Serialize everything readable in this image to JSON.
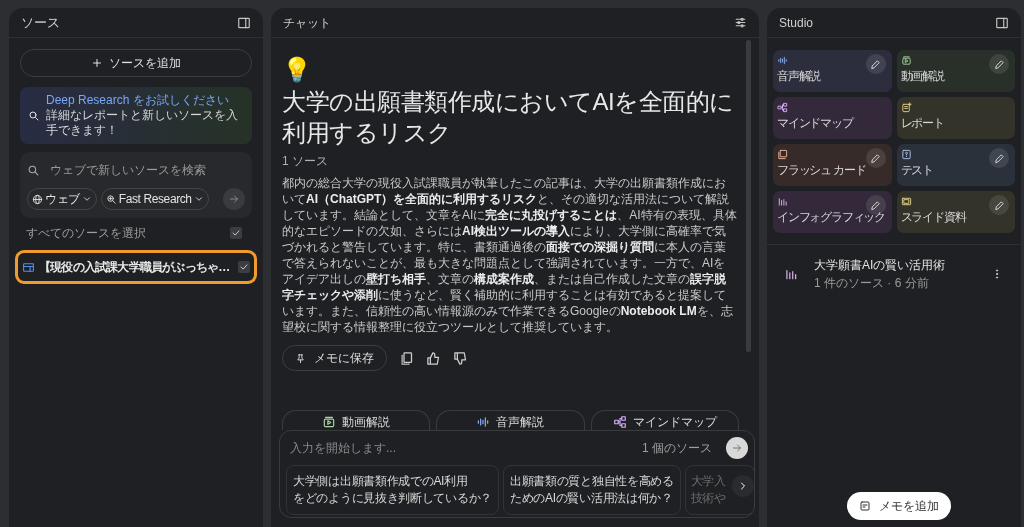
{
  "sources_panel": {
    "title": "ソース",
    "add_button": "ソースを追加",
    "promo": {
      "link": "Deep Research をお試しください",
      "text": "詳細なレポートと新しいソースを入手できます！"
    },
    "search": {
      "placeholder": "ウェブで新しいソースを検索",
      "chips": [
        "ウェブ",
        "Fast Research"
      ]
    },
    "select_all": {
      "label": "すべてのソースを選択",
      "checked": true
    },
    "sources": [
      {
        "title": "【現役の入試課大学職員がぶっちゃ…",
        "checked": true,
        "highlighted": true
      }
    ]
  },
  "chat_panel": {
    "title": "チャット",
    "emoji": "💡",
    "heading": "大学の出願書類作成においてAIを全面的に利用するリスク",
    "source_count": "1 ソース",
    "summary": "都内の総合大学の現役入試課職員が執筆したこの記事は、大学の出願書類作成において**AI（ChatGPT）を全面的に利用するリスク**と、その適切な活用法について解説しています。結論として、文章をAIに**完全に丸投げすることは**、AI特有の表現、具体的なエピソードの欠如、さらには**AI検出ツールの導入**により、大学側に高確率で気づかれると警告しています。特に、書類通過後の**面接での深掘り質問**に本人の言葉で答えられないことが、最も大きな問題点として強調されています。一方で、AIをアイデア出しの**壁打ち相手**、文章の**構成案作成**、または自己作成した文章の**誤字脱字チェックや添削**に使うなど、賢く補助的に利用することは有効であると提案しています。また、信頼性の高い情報源のみで作業できるGoogleの**Notebook LM**を、志望校に関する情報整理に役立つツールとして推奨しています。",
    "save_button": "メモに保存",
    "chips": [
      {
        "kind": "video",
        "label": "動画解説"
      },
      {
        "kind": "audio",
        "label": "音声解説"
      },
      {
        "kind": "mindmap",
        "label": "マインドマップ"
      }
    ],
    "input": {
      "placeholder": "入力を開始します...",
      "source_count": "1 個のソース"
    },
    "suggestions": [
      {
        "lines": [
          "大学側は出願書類作成でのAI利用",
          "をどのように見抜き判断しているか？"
        ],
        "faded": false
      },
      {
        "lines": [
          "出願書類の質と独自性を高める",
          "ためのAIの賢い活用法は何か？"
        ],
        "faded": false
      },
      {
        "lines": [
          "大学入",
          "技術や"
        ],
        "faded": true
      }
    ]
  },
  "studio_panel": {
    "title": "Studio",
    "tiles": [
      {
        "kind": "audio",
        "label": "音声解説",
        "color": "#2c2e3e",
        "editable": true
      },
      {
        "kind": "video",
        "label": "動画解説",
        "color": "#29302a",
        "editable": true
      },
      {
        "kind": "mindmap",
        "label": "マインドマップ",
        "color": "#33293a",
        "editable": false
      },
      {
        "kind": "report",
        "label": "レポート",
        "color": "#34332a",
        "editable": false
      },
      {
        "kind": "flashcard",
        "label": "フラッシュ カード",
        "color": "#362b29",
        "editable": true
      },
      {
        "kind": "quiz",
        "label": "テスト",
        "color": "#2b313b",
        "editable": true
      },
      {
        "kind": "infographic",
        "label": "インフォグラフィック",
        "color": "#33293a",
        "editable": true
      },
      {
        "kind": "slides",
        "label": "スライド資料",
        "color": "#34332a",
        "editable": true
      }
    ],
    "notes": [
      {
        "title": "大学願書AIの賢い活用術",
        "meta": "1 件のソース · 6 分前"
      }
    ],
    "add_note_button": "メモを追加"
  }
}
